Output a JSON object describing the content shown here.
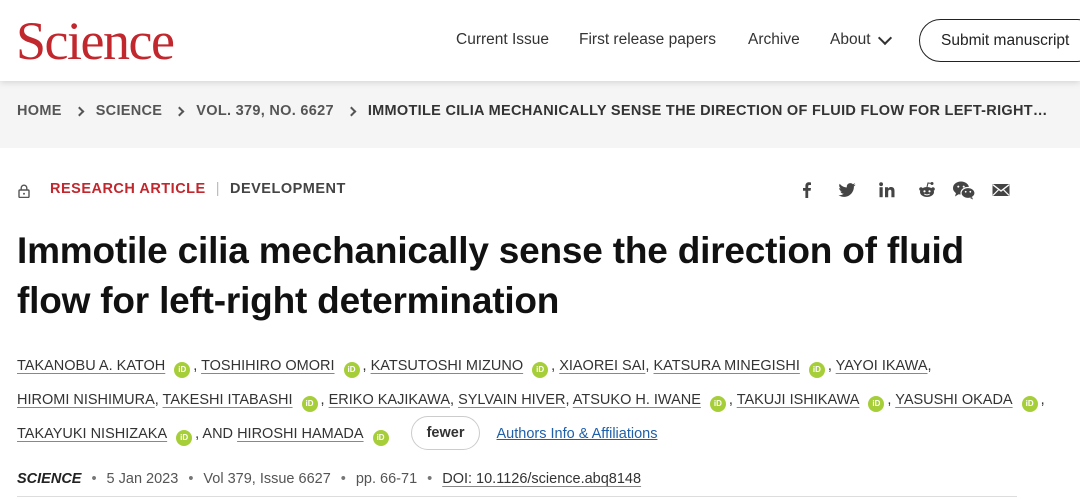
{
  "header": {
    "logo": "Science",
    "nav": [
      "Current Issue",
      "First release papers",
      "Archive",
      "About"
    ],
    "submit_label": "Submit manuscript"
  },
  "breadcrumb": {
    "items": [
      "HOME",
      "SCIENCE",
      "VOL. 379, NO. 6627"
    ],
    "current": "IMMOTILE CILIA MECHANICALLY SENSE THE DIRECTION OF FLUID FLOW FOR LEFT-RIGHT…"
  },
  "article": {
    "type_label": "RESEARCH ARTICLE",
    "subject": "DEVELOPMENT",
    "title": "Immotile cilia mechanically sense the direction of fluid flow for left-right determination",
    "share_icons": [
      "facebook-icon",
      "twitter-icon",
      "linkedin-icon",
      "reddit-icon",
      "wechat-icon",
      "email-icon"
    ],
    "orcid_badge": "iD",
    "authors": [
      {
        "name": "TAKANOBU A. KATOH",
        "orcid": true
      },
      {
        "name": "TOSHIHIRO OMORI",
        "orcid": true
      },
      {
        "name": "KATSUTOSHI MIZUNO",
        "orcid": true
      },
      {
        "name": "XIAOREI SAI",
        "orcid": false
      },
      {
        "name": "KATSURA MINEGISHI",
        "orcid": true
      },
      {
        "name": "YAYOI IKAWA",
        "orcid": false
      },
      {
        "name": "HIROMI NISHIMURA",
        "orcid": false
      },
      {
        "name": "TAKESHI ITABASHI",
        "orcid": true
      },
      {
        "name": "ERIKO KAJIKAWA",
        "orcid": false
      },
      {
        "name": "SYLVAIN HIVER",
        "orcid": false
      },
      {
        "name": "ATSUKO H. IWANE",
        "orcid": true
      },
      {
        "name": "TAKUJI ISHIKAWA",
        "orcid": true
      },
      {
        "name": "YASUSHI OKADA",
        "orcid": true
      },
      {
        "name": "TAKAYUKI NISHIZAKA",
        "orcid": true
      },
      {
        "name": "HIROSHI HAMADA",
        "orcid": true
      }
    ],
    "and_text": "AND",
    "fewer_label": "fewer",
    "affiliations_label": "Authors Info & Affiliations",
    "citation": {
      "journal": "SCIENCE",
      "date": "5 Jan 2023",
      "volume": "Vol 379, Issue 6627",
      "pages": "pp. 66-71",
      "doi": "DOI: 10.1126/science.abq8148"
    }
  },
  "colors": {
    "brand": "#c1272d",
    "link": "#1f5fa8",
    "orcid": "#a6ce39"
  }
}
